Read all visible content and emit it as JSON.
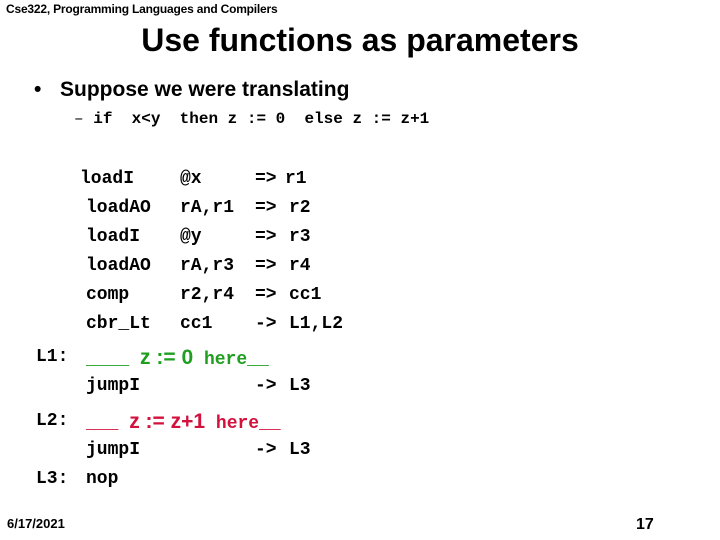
{
  "header": {
    "course": "Cse322, Programming Languages and Compilers",
    "title": "Use functions as parameters"
  },
  "bullet": {
    "marker": "•",
    "text": "Suppose we were translating",
    "sub_marker": "–",
    "sub_text": "if  x<y  then z := 0  else z := z+1"
  },
  "code": {
    "lines": [
      {
        "op": "loadI",
        "args": "@x    ",
        "arrow": "=>",
        "dest": "r1"
      },
      {
        "op": "loadAO",
        "args": "rA,r1 ",
        "arrow": "=>",
        "dest": "r2"
      },
      {
        "op": "loadI",
        "args": "@y    ",
        "arrow": "=>",
        "dest": "r3"
      },
      {
        "op": "loadAO",
        "args": "rA,r3 ",
        "arrow": "=>",
        "dest": "r4"
      },
      {
        "op": "comp",
        "args": "r2,r4 ",
        "arrow": "=>",
        "dest": "cc1"
      },
      {
        "op": "cbr_Lt",
        "args": "cc1   ",
        "arrow": "->",
        "dest": "L1,L2"
      }
    ],
    "l1": {
      "label": "L1:",
      "blank_pre": "____",
      "insert": "z := 0",
      "here": "here",
      "blank_post": "__",
      "jump_op": "jumpI",
      "jump_arrow": "->",
      "jump_dest": "L3"
    },
    "l2": {
      "label": "L2:",
      "blank_pre": "___",
      "insert": "z := z+1",
      "here": "here",
      "blank_post": "__",
      "jump_op": "jumpI",
      "jump_arrow": "->",
      "jump_dest": "L3"
    },
    "l3": {
      "label": "L3:",
      "op": "nop"
    }
  },
  "colors": {
    "l1_highlight": "#1f9e1f",
    "l2_highlight": "#d2113c"
  },
  "footer": {
    "date": "6/17/2021",
    "page": "17"
  }
}
